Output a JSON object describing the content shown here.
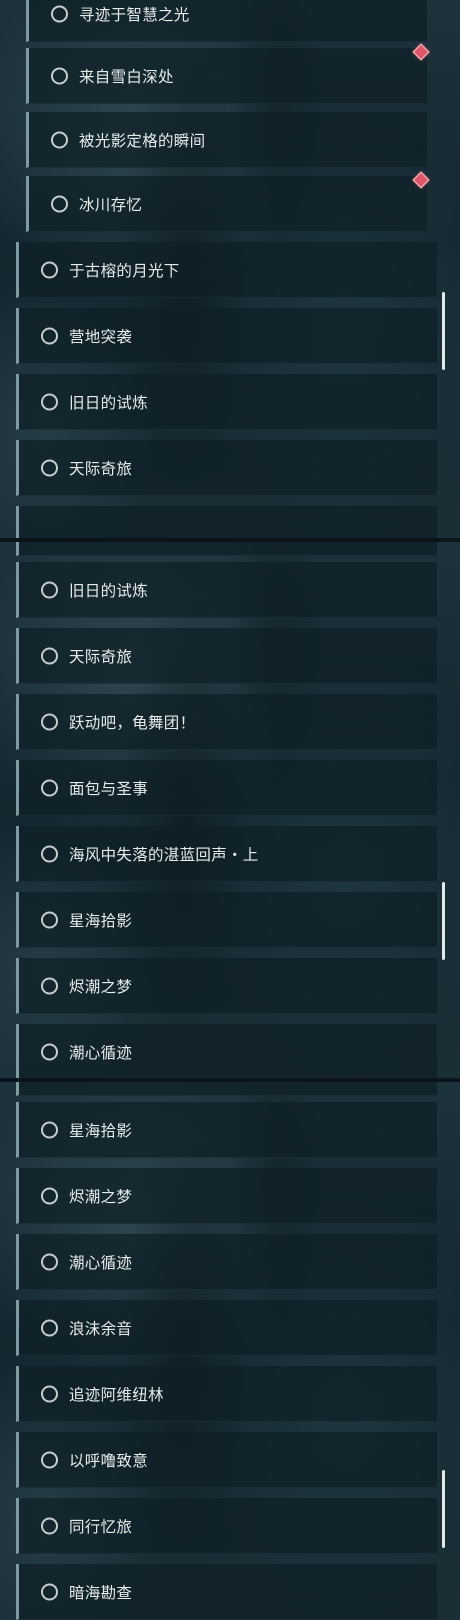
{
  "panel1": {
    "sub_items": [
      {
        "label": "寻迹于智慧之光"
      },
      {
        "label": "来自雪白深处"
      },
      {
        "label": "被光影定格的瞬间"
      },
      {
        "label": "冰川存忆"
      }
    ],
    "items": [
      {
        "label": "于古榕的月光下"
      },
      {
        "label": "营地突袭"
      },
      {
        "label": "旧日的试炼"
      },
      {
        "label": "天际奇旅"
      }
    ]
  },
  "panel2": {
    "items": [
      {
        "label": "旧日的试炼"
      },
      {
        "label": "天际奇旅"
      },
      {
        "label": "跃动吧，龟舞团！"
      },
      {
        "label": "面包与圣事"
      },
      {
        "label": "海风中失落的湛蓝回声・上"
      },
      {
        "label": "星海拾影"
      },
      {
        "label": "烬潮之梦"
      },
      {
        "label": "潮心循迹"
      }
    ]
  },
  "panel3": {
    "items": [
      {
        "label": "星海拾影"
      },
      {
        "label": "烬潮之梦"
      },
      {
        "label": "潮心循迹"
      },
      {
        "label": "浪沫余音"
      },
      {
        "label": "追迹阿维纽林"
      },
      {
        "label": "以呼噜致意"
      },
      {
        "label": "同行忆旅"
      },
      {
        "label": "暗海勘查"
      }
    ]
  },
  "colors": {
    "accent_border": "#7d9aa3",
    "badge": "#e0596a",
    "text": "#e6ecee"
  },
  "icons": {
    "status": "circle-outline-icon",
    "new": "red-diamond-badge-icon"
  }
}
